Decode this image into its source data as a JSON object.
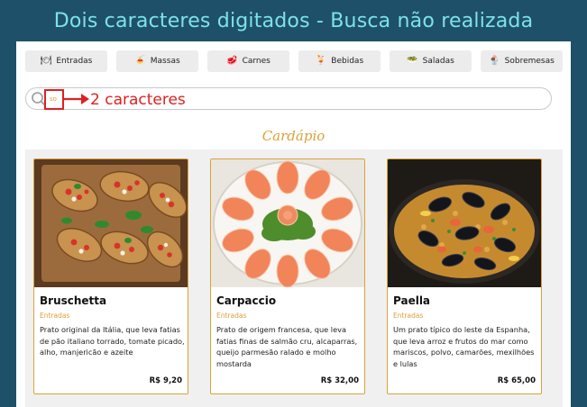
{
  "banner": {
    "title": "Dois caracteres digitados - Busca não realizada"
  },
  "categories": [
    {
      "label": "Entradas",
      "icon": "🍽",
      "icon_name": "entradas-icon"
    },
    {
      "label": "Massas",
      "icon": "🍝",
      "icon_name": "massas-icon"
    },
    {
      "label": "Carnes",
      "icon": "🥩",
      "icon_name": "carnes-icon"
    },
    {
      "label": "Bebidas",
      "icon": "🍹",
      "icon_name": "bebidas-icon"
    },
    {
      "label": "Saladas",
      "icon": "🥗",
      "icon_name": "saladas-icon"
    },
    {
      "label": "Sobremesas",
      "icon": "🍨",
      "icon_name": "sobremesas-icon"
    }
  ],
  "search": {
    "value": "so"
  },
  "annotation": {
    "text": "2 caracteres",
    "color": "#e02020"
  },
  "section": {
    "title": "Cardápio"
  },
  "menu_items": [
    {
      "name": "Bruschetta",
      "category": "Entradas",
      "description": "Prato original da Itália, que leva fatias de pão italiano torrado, tomate picado, alho, manjericão e azeite",
      "price": "R$ 9,20"
    },
    {
      "name": "Carpaccio",
      "category": "Entradas",
      "description": "Prato de origem francesa, que leva fatias finas de salmão cru, alcaparras, queijo parmesão ralado e molho mostarda",
      "price": "R$ 32,00"
    },
    {
      "name": "Paella",
      "category": "Entradas",
      "description": "Um prato típico do leste da Espanha, que leva arroz e frutos do mar como mariscos, polvo, camarões, mexilhões e lulas",
      "price": "R$ 65,00"
    }
  ],
  "colors": {
    "background": "#1f5069",
    "banner_text": "#7be3ea",
    "accent": "#d9a23a",
    "highlight": "#e02020"
  }
}
